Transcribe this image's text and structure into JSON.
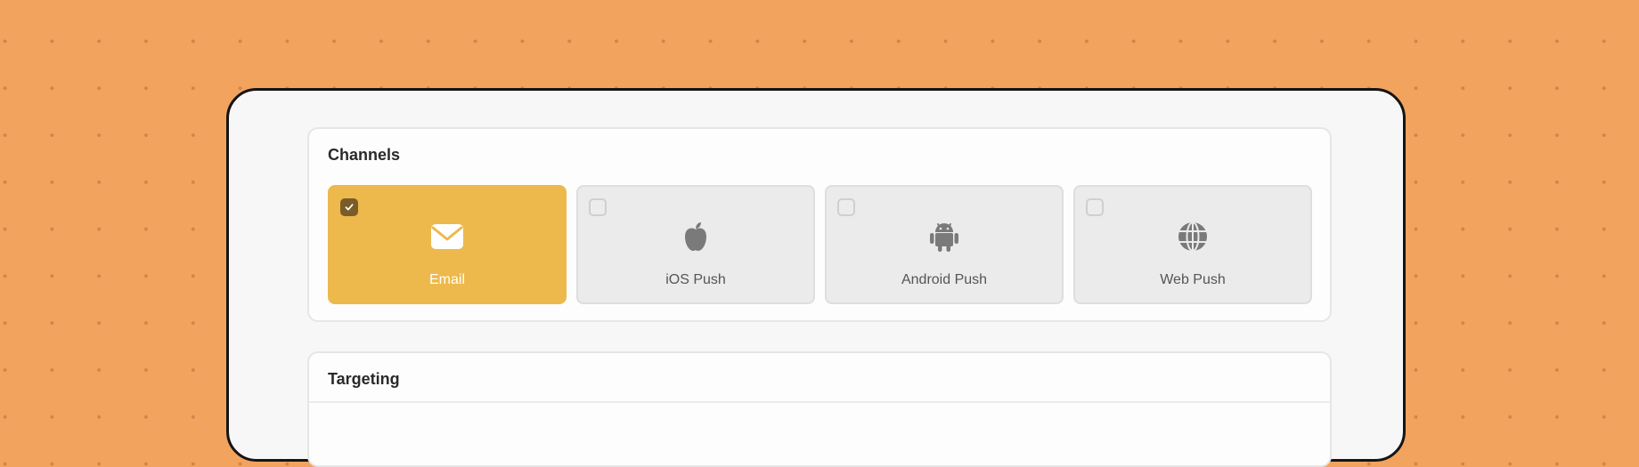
{
  "sections": {
    "channels_title": "Channels",
    "targeting_title": "Targeting"
  },
  "channels": [
    {
      "label": "Email",
      "icon": "mail-icon",
      "selected": true
    },
    {
      "label": "iOS Push",
      "icon": "apple-icon",
      "selected": false
    },
    {
      "label": "Android Push",
      "icon": "android-icon",
      "selected": false
    },
    {
      "label": "Web Push",
      "icon": "globe-icon",
      "selected": false
    }
  ],
  "colors": {
    "background": "#f2a35e",
    "selected_channel": "#edb94c",
    "checkbox_checked": "#7a5c28",
    "window_border": "#151515"
  }
}
